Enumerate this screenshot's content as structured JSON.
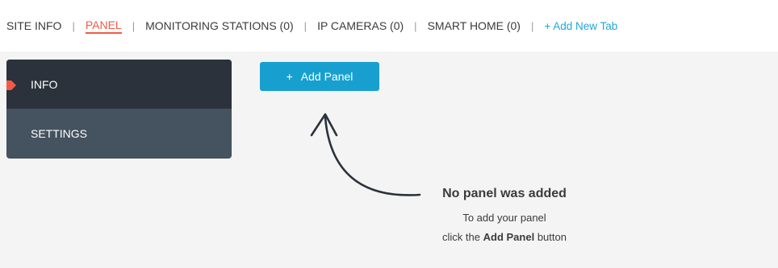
{
  "tabs": [
    {
      "label": "SITE INFO"
    },
    {
      "label": "PANEL"
    },
    {
      "label": "MONITORING STATIONS (0)"
    },
    {
      "label": "IP CAMERAS (0)"
    },
    {
      "label": "SMART HOME (0)"
    }
  ],
  "tab_separator": "|",
  "add_tab_label": "+ Add New Tab",
  "active_tab": "PANEL",
  "sidebar": {
    "items": [
      {
        "label": "INFO"
      },
      {
        "label": "SETTINGS"
      }
    ]
  },
  "add_panel": {
    "plus": "+",
    "label": "Add Panel"
  },
  "empty_state": {
    "title": "No panel was added",
    "line1": "To add your panel",
    "line2_prefix": "click the",
    "line2_bold": "Add Panel",
    "line2_suffix": "button"
  },
  "colors": {
    "accent": "#ef5b48",
    "link": "#21a6d7",
    "button": "#17a0cf",
    "sidebar_active": "#2b323b",
    "sidebar_bg": "#45525f"
  },
  "icons": {
    "pointer_arrow": "curved-arrow-icon",
    "marker": "active-marker-icon"
  }
}
